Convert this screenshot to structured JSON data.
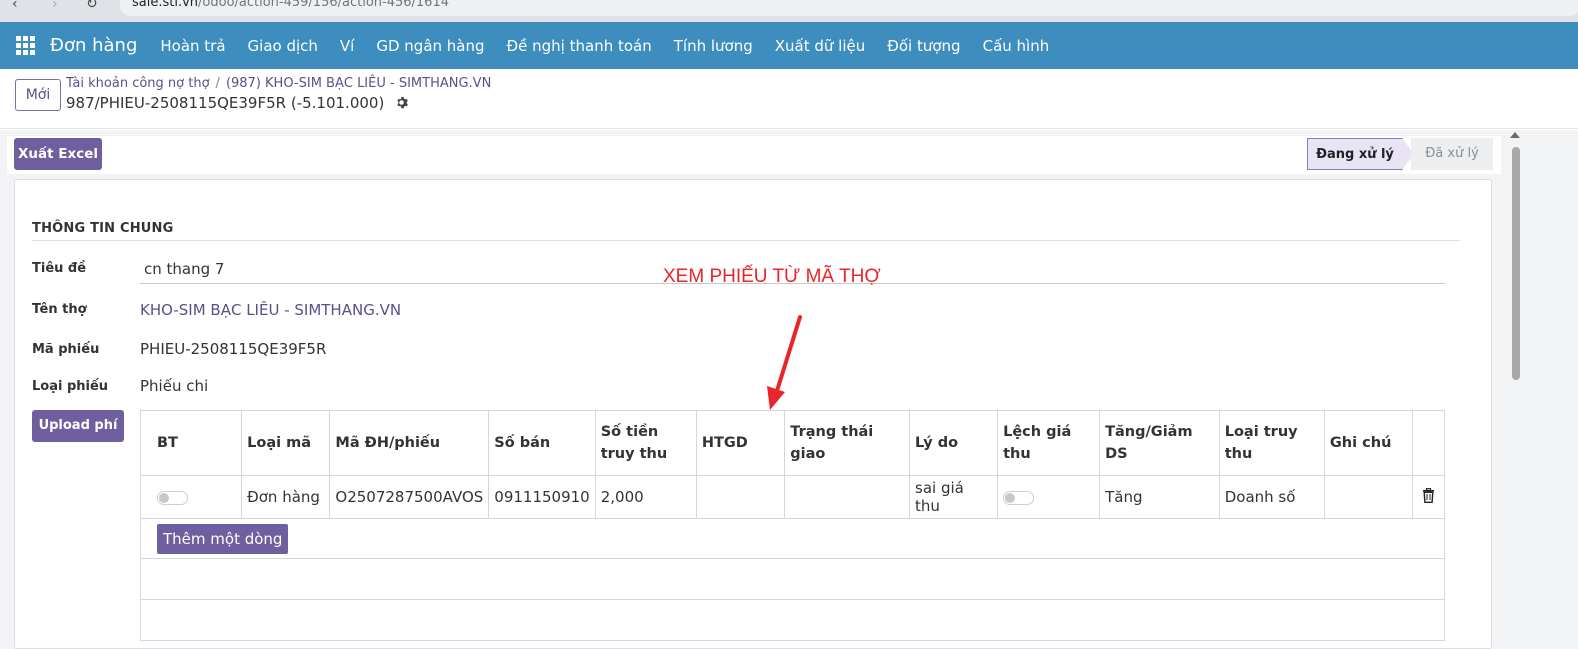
{
  "browser": {
    "url_host": "sale.sti.vn",
    "url_path": "/odoo/action-459/156/action-456/1614"
  },
  "navbar": {
    "brand": "Đơn hàng",
    "items": [
      {
        "label": "Hoàn trả"
      },
      {
        "label": "Giao dịch"
      },
      {
        "label": "Ví"
      },
      {
        "label": "GD ngân hàng"
      },
      {
        "label": "Đề nghị thanh toán"
      },
      {
        "label": "Tính lương"
      },
      {
        "label": "Xuất dữ liệu"
      },
      {
        "label": "Đối tượng"
      },
      {
        "label": "Cấu hình"
      }
    ]
  },
  "control": {
    "new_button": "Mới",
    "breadcrumb_parent": "Tài khoản công nợ thợ",
    "breadcrumb_separator": "/",
    "breadcrumb_current": "(987) KHO-SIM BẠC LIÊU - SIMTHANG.VN",
    "record_title": "987/PHIEU-2508115QE39F5R (-5.101.000)"
  },
  "statusbar": {
    "export_button": "Xuất Excel",
    "stages": [
      "Đang xử lý",
      "Đã xử lý"
    ],
    "active_stage": "Đang xử lý"
  },
  "form": {
    "section_title": "THÔNG TIN CHUNG",
    "fields": {
      "title_label": "Tiêu đề",
      "title_value": "cn thang 7",
      "worker_label": "Tên thợ",
      "worker_value": "KHO-SIM BẠC LIÊU - SIMTHANG.VN",
      "code_label": "Mã phiếu",
      "code_value": "PHIEU-2508115QE39F5R",
      "type_label": "Loại phiếu",
      "type_value": "Phiếu chi"
    },
    "upload_button": "Upload phí"
  },
  "table": {
    "headers": [
      "BT",
      "Loại mã",
      "Mã ĐH/phiếu",
      "Số bán",
      "Số tiền truy thu",
      "HTGD",
      "Trạng thái giao",
      "Lý do",
      "Lệch giá thu",
      "Tăng/Giảm DS",
      "Loại truy thu",
      "Ghi chú"
    ],
    "rows": [
      {
        "bt": false,
        "loai_ma": "Đơn hàng",
        "ma_dh": "O2507287500AVOS",
        "so_ban": "0911150910",
        "so_tien": "2,000",
        "htgd": "",
        "trang_thai": "",
        "ly_do": "sai giá thu",
        "lech_gia": false,
        "tang_giam": "Tăng",
        "loai_truy_thu": "Doanh số",
        "ghi_chu": ""
      }
    ],
    "add_line_button": "Thêm một dòng"
  },
  "annotation": {
    "text": "XEM PHIẾU TỪ MÃ THỢ",
    "color": "#e8252a"
  },
  "colors": {
    "navbar": "#3d8dbf",
    "primary": "#6f5f9e",
    "link": "#5c4f8b"
  }
}
